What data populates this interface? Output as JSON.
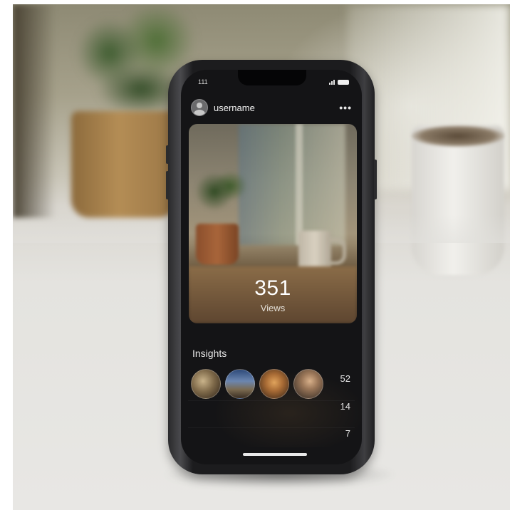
{
  "status_bar": {
    "time": "111"
  },
  "post": {
    "username": "username",
    "more_icon": "ellipsis-icon",
    "views_count": "351",
    "views_label": "Views"
  },
  "insights": {
    "title": "Insights",
    "stats": [
      "52",
      "14",
      "7"
    ]
  },
  "colors": {
    "screen_background": "#141416",
    "text_primary": "#f2f2f2"
  }
}
